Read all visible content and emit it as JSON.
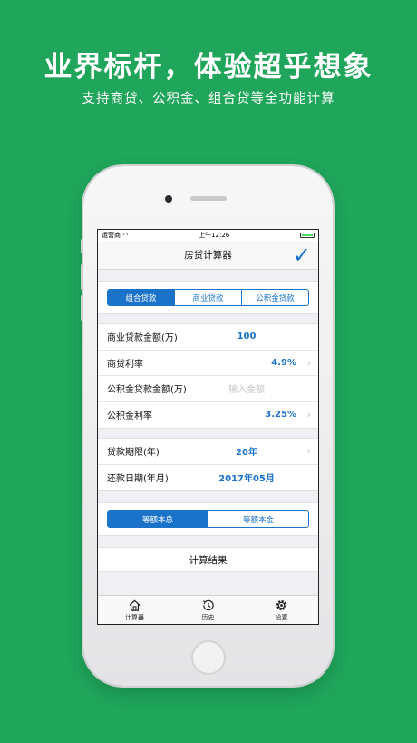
{
  "promo": {
    "headline": "业界标杆，体验超乎想象",
    "subline": "支持商贷、公积金、组合贷等全功能计算"
  },
  "status_bar": {
    "carrier": "运营商",
    "time": "上午12:26"
  },
  "nav": {
    "title": "房贷计算器"
  },
  "loan_type_tabs": [
    {
      "label": "组合贷款",
      "active": true
    },
    {
      "label": "商业贷款",
      "active": false
    },
    {
      "label": "公积金贷款",
      "active": false
    }
  ],
  "loan_fields": {
    "commercial_amount": {
      "label": "商业贷款金额(万)",
      "value": "100"
    },
    "commercial_rate": {
      "label": "商贷利率",
      "value": "4.9%"
    },
    "fund_amount": {
      "label": "公积金贷款金额(万)",
      "placeholder": "输入金额"
    },
    "fund_rate": {
      "label": "公积金利率",
      "value": "3.25%"
    }
  },
  "term_fields": {
    "term": {
      "label": "贷款期限(年)",
      "value": "20年"
    },
    "repay_date": {
      "label": "还款日期(年月)",
      "value": "2017年05月"
    }
  },
  "repay_method_tabs": [
    {
      "label": "等额本息",
      "active": true
    },
    {
      "label": "等额本金",
      "active": false
    }
  ],
  "calculate_button": "计算结果",
  "tab_bar": {
    "items": [
      {
        "label": "计算器",
        "icon": "house-icon"
      },
      {
        "label": "历史",
        "icon": "history-icon"
      },
      {
        "label": "设置",
        "icon": "gear-icon"
      }
    ]
  },
  "colors": {
    "background": "#1fa65a",
    "accent": "#1a73c9"
  }
}
